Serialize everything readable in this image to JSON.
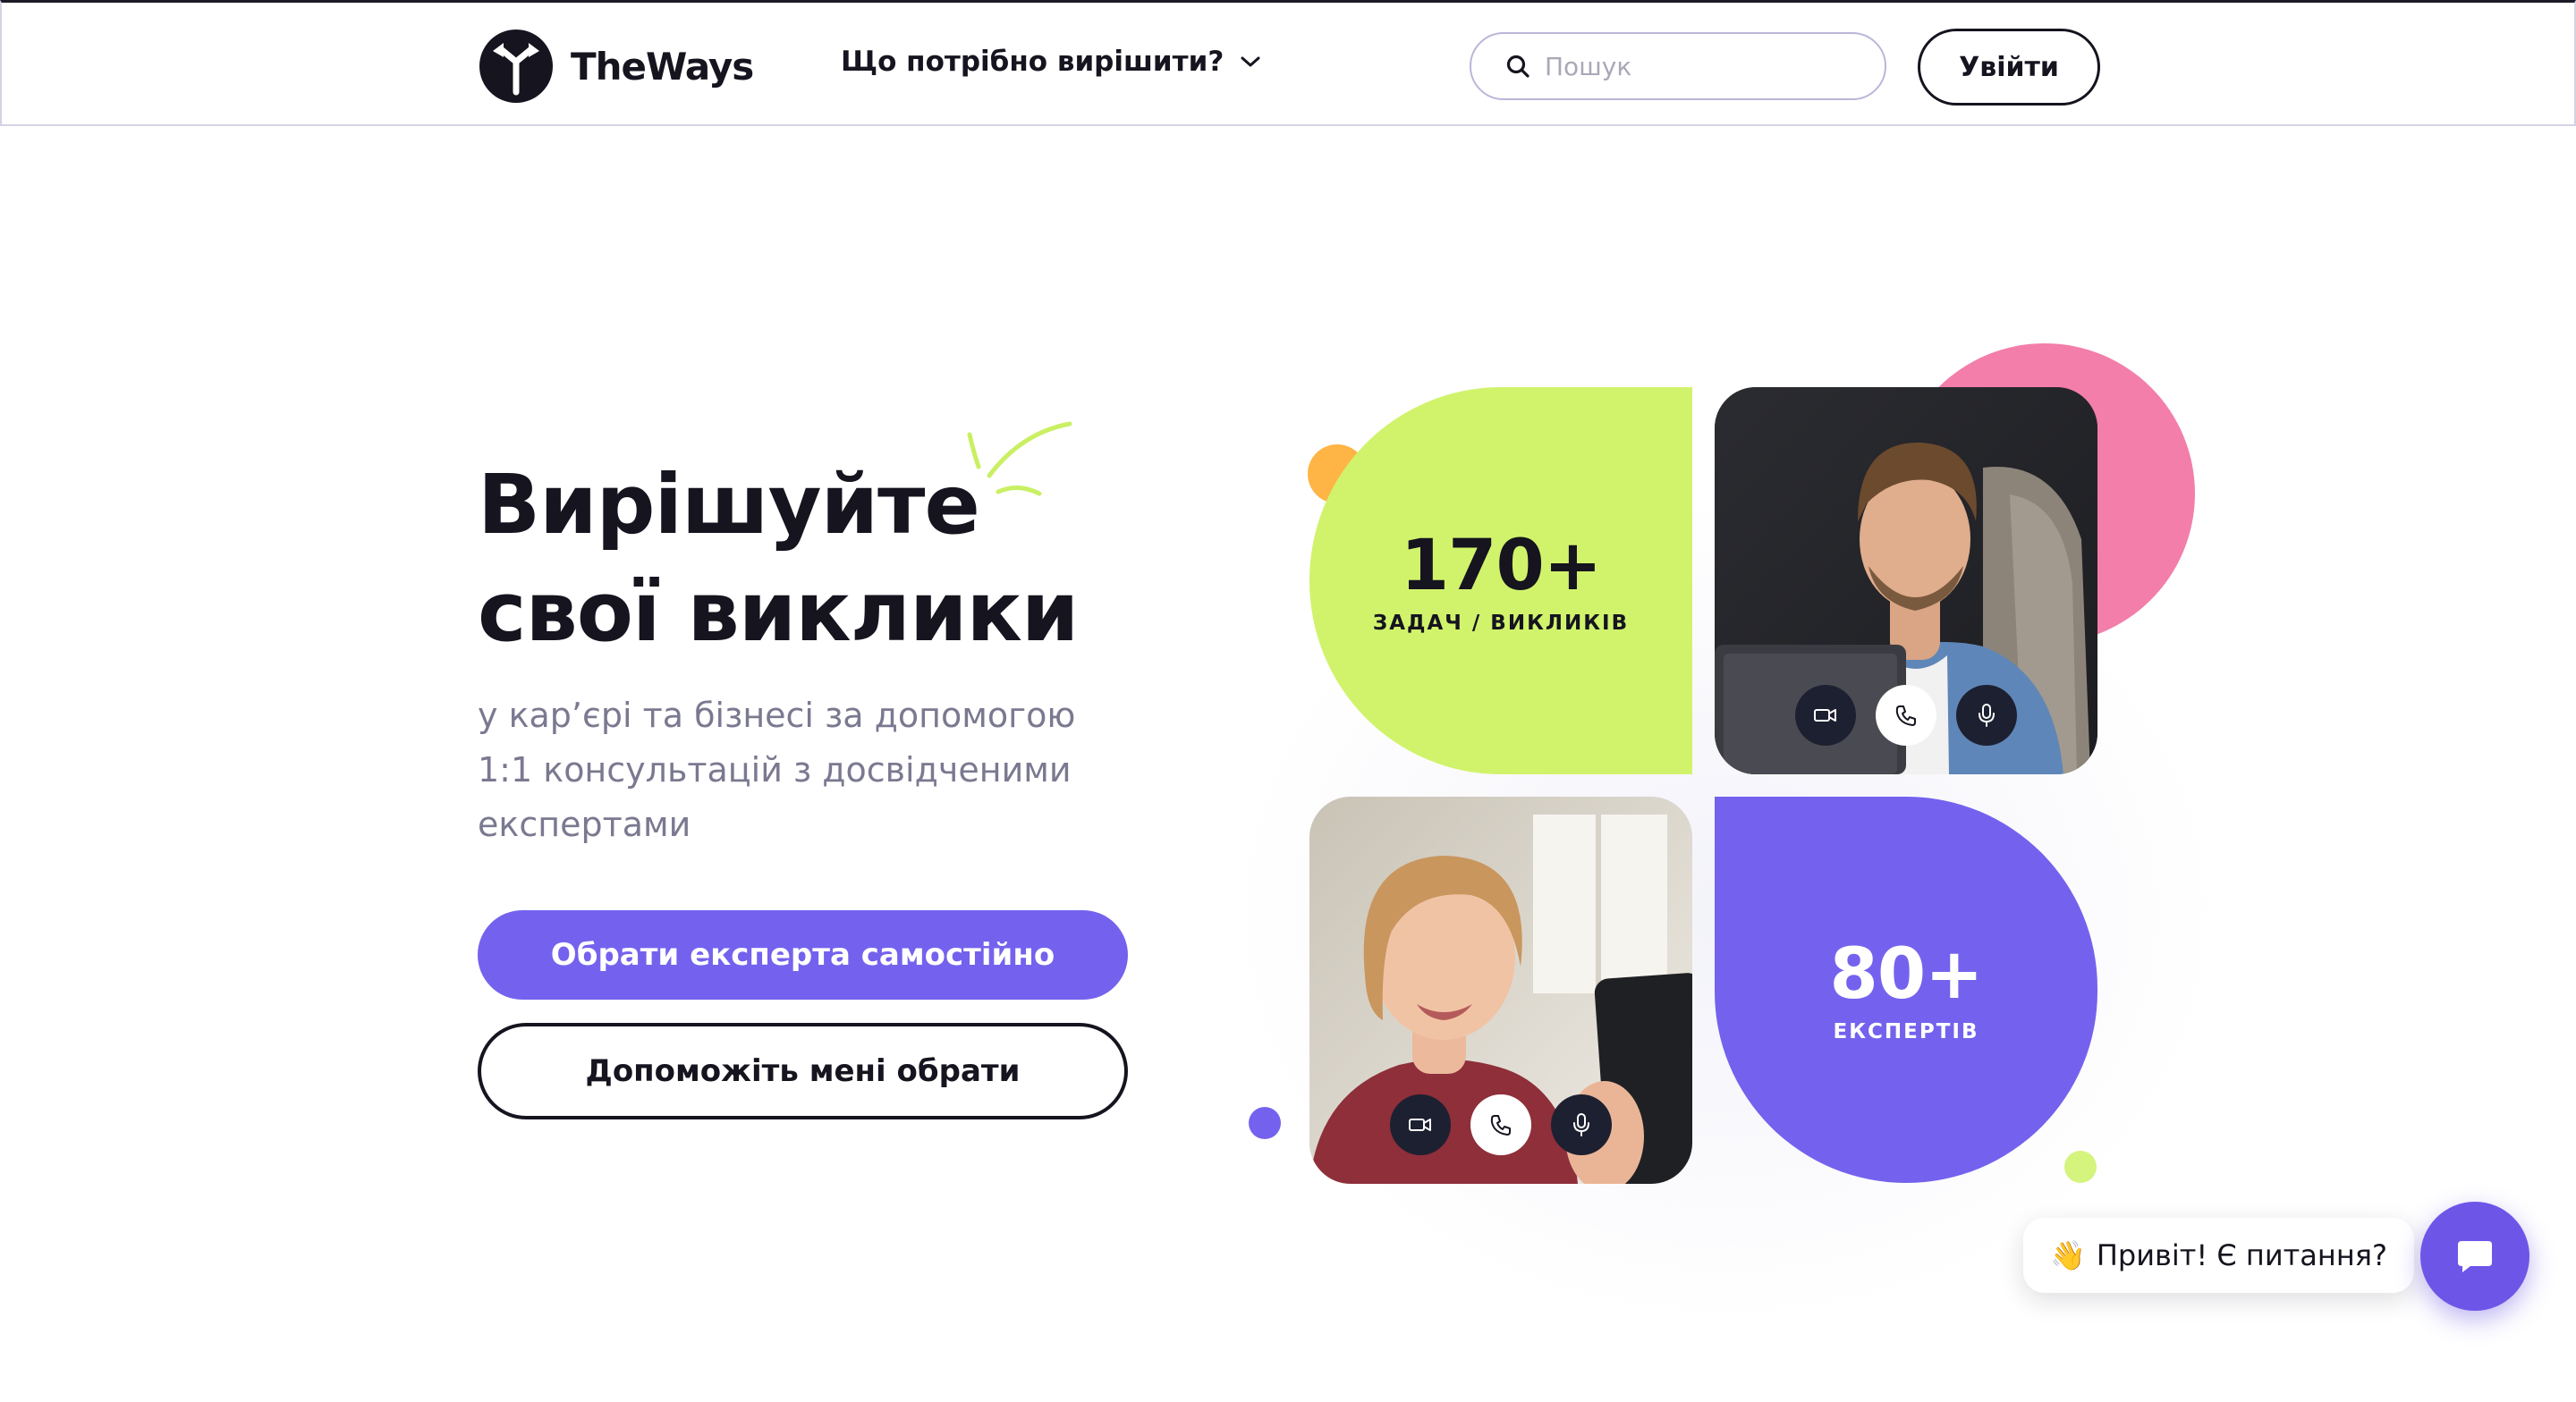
{
  "header": {
    "brand": "TheWays",
    "nav_dropdown_label": "Що потрібно вирішити?",
    "search_placeholder": "Пошук",
    "login_label": "Увійти"
  },
  "hero": {
    "title_line1": "Вирішуйте",
    "title_line2": "свої виклики",
    "subtitle_line1": "у кар’єрі та бізнесі за допомогою",
    "subtitle_line2": "1:1 консультацій з досвідченими",
    "subtitle_line3": "експертами",
    "primary_button": "Обрати експерта самостійно",
    "secondary_button": "Допоможіть мені обрати"
  },
  "stats": {
    "tasks_value": "170+",
    "tasks_label": "ЗАДАЧ / ВИКЛИКІВ",
    "experts_value": "80+",
    "experts_label": "ЕКСПЕРТІВ"
  },
  "chat": {
    "emoji": "👋",
    "greeting": "Привіт! Є питання?"
  },
  "colors": {
    "accent_purple": "#7462ee",
    "lime": "#d1f36c",
    "pink": "#f27ea9",
    "orange": "#ffb446",
    "dark": "#15141f"
  },
  "icons": [
    "logo-icon",
    "chevron-down-icon",
    "search-icon",
    "doodle-icon",
    "video-camera-icon",
    "phone-icon",
    "microphone-icon",
    "chat-icon"
  ]
}
